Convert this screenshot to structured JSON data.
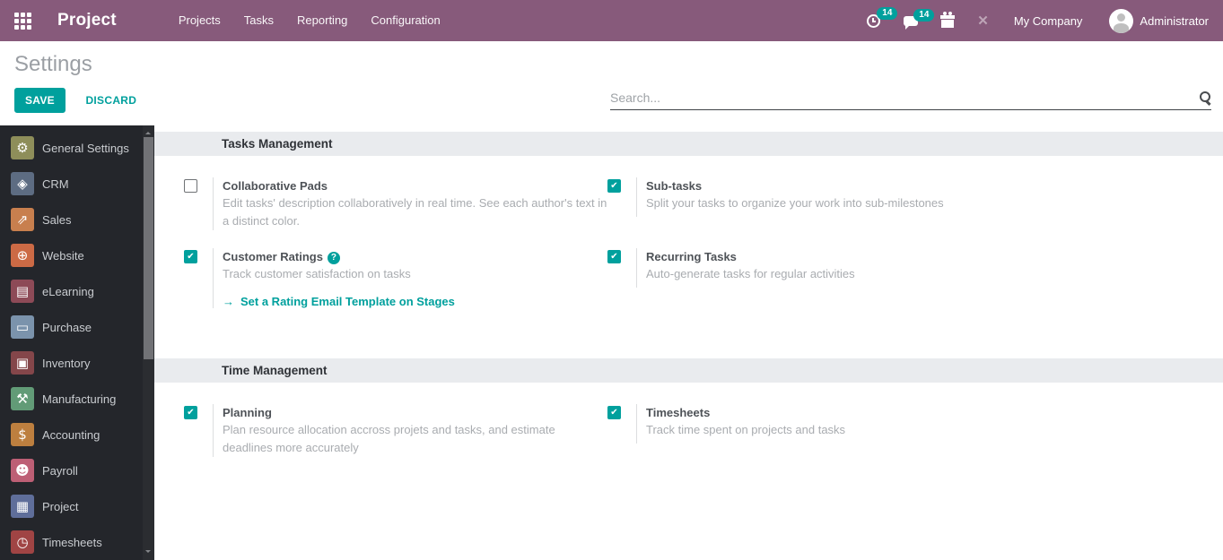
{
  "topbar": {
    "brand": "Project",
    "menus": [
      {
        "label": "Projects"
      },
      {
        "label": "Tasks"
      },
      {
        "label": "Reporting"
      },
      {
        "label": "Configuration"
      }
    ],
    "activity_badge": "14",
    "message_badge": "14",
    "company": "My Company",
    "user": "Administrator"
  },
  "control_panel": {
    "title": "Settings",
    "save_label": "SAVE",
    "discard_label": "DISCARD",
    "search_placeholder": "Search..."
  },
  "sidebar": {
    "items": [
      {
        "label": "General Settings",
        "icon": "gear-icon",
        "glyph": "⚙",
        "color": "#8e8e5a"
      },
      {
        "label": "CRM",
        "icon": "handshake-icon",
        "glyph": "◈",
        "color": "#5d6c82"
      },
      {
        "label": "Sales",
        "icon": "chart-icon",
        "glyph": "⇗",
        "color": "#c87f4e"
      },
      {
        "label": "Website",
        "icon": "globe-icon",
        "glyph": "⊕",
        "color": "#cc6a45"
      },
      {
        "label": "eLearning",
        "icon": "presentation-icon",
        "glyph": "▤",
        "color": "#8d4a57"
      },
      {
        "label": "Purchase",
        "icon": "card-icon",
        "glyph": "▭",
        "color": "#7b93ac"
      },
      {
        "label": "Inventory",
        "icon": "box-icon",
        "glyph": "▣",
        "color": "#84464a"
      },
      {
        "label": "Manufacturing",
        "icon": "wrench-icon",
        "glyph": "⚒",
        "color": "#629b77"
      },
      {
        "label": "Accounting",
        "icon": "invoice-icon",
        "glyph": "$",
        "color": "#bd7f3f"
      },
      {
        "label": "Payroll",
        "icon": "employee-icon",
        "glyph": "☻",
        "color": "#bd5f75"
      },
      {
        "label": "Project",
        "icon": "puzzle-icon",
        "glyph": "▦",
        "color": "#5f6e9a"
      },
      {
        "label": "Timesheets",
        "icon": "stopwatch-icon",
        "glyph": "◷",
        "color": "#a04444"
      }
    ]
  },
  "sections": [
    {
      "title": "Tasks Management",
      "settings": [
        {
          "label": "Collaborative Pads",
          "checked": false,
          "description": "Edit tasks' description collaboratively in real time. See each author's text in a distinct color."
        },
        {
          "label": "Sub-tasks",
          "checked": true,
          "description": "Split your tasks to organize your work into sub-milestones"
        },
        {
          "label": "Customer Ratings",
          "checked": true,
          "description": "Track customer satisfaction on tasks",
          "link": "Set a Rating Email Template on Stages"
        },
        {
          "label": "Recurring Tasks",
          "checked": true,
          "description": "Auto-generate tasks for regular activities"
        }
      ]
    },
    {
      "title": "Time Management",
      "settings": [
        {
          "label": "Planning",
          "checked": true,
          "description": "Plan resource allocation accross projets and tasks, and estimate deadlines more accurately"
        },
        {
          "label": "Timesheets",
          "checked": true,
          "description": "Track time spent on projects and tasks"
        }
      ]
    }
  ],
  "icons": {
    "help_glyph": "?",
    "link_arrow": "→",
    "tools_glyph": "✕"
  },
  "colors": {
    "topbar": "#875A7B",
    "accent": "#00A09D",
    "sidebar_bg": "#24262b"
  }
}
